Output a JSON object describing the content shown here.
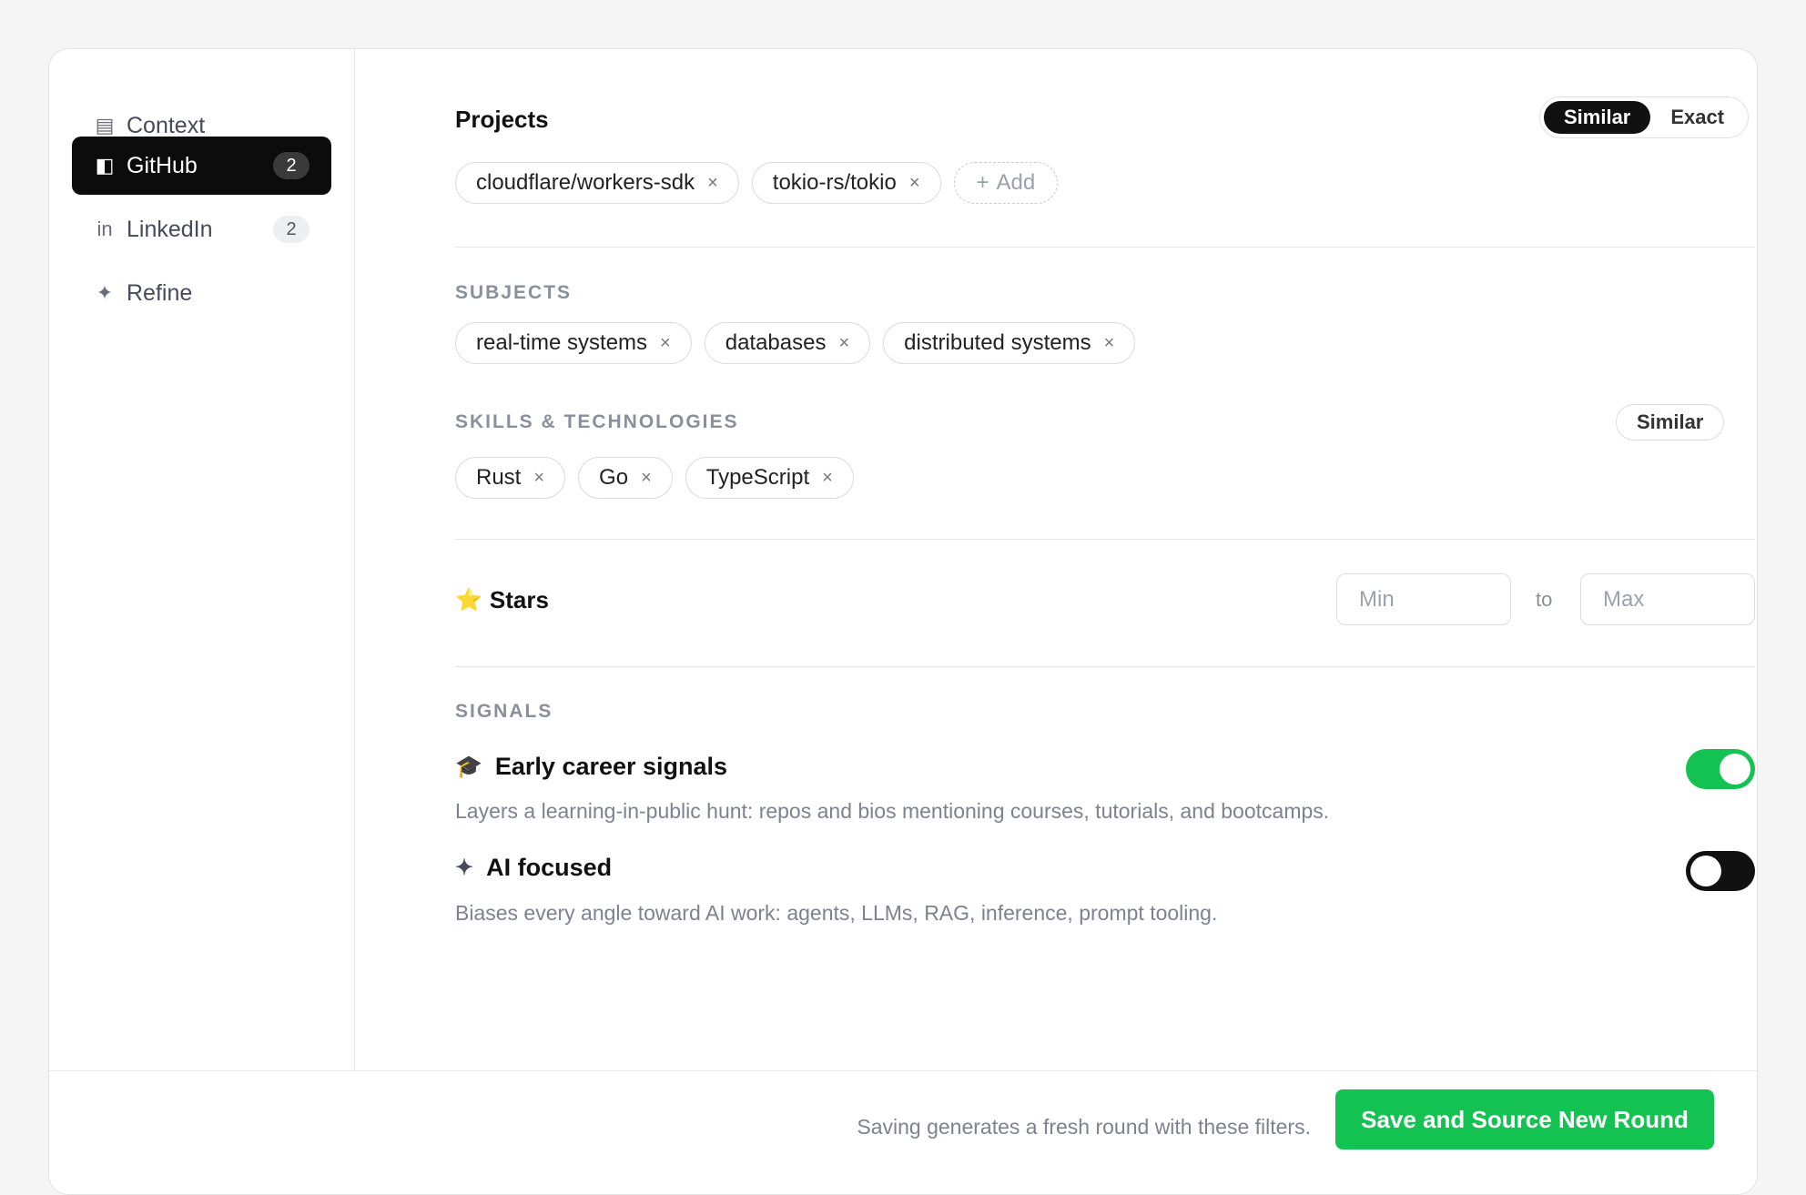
{
  "sidebar": {
    "items": [
      {
        "icon": "▤",
        "label": "Context",
        "badge": ""
      },
      {
        "icon": "◧",
        "label": "GitHub",
        "badge": "2"
      },
      {
        "icon": "in",
        "label": "LinkedIn",
        "badge": "2"
      },
      {
        "icon": "✦",
        "label": "Refine",
        "badge": ""
      }
    ],
    "active_index": 1
  },
  "projects": {
    "title": "Projects",
    "mode_options": [
      "Similar",
      "Exact"
    ],
    "selected_mode": "Similar",
    "chips": [
      "cloudflare/workers-sdk",
      "tokio-rs/tokio"
    ],
    "add_label": "Add",
    "remove_glyph": "×"
  },
  "subjects": {
    "label": "SUBJECTS",
    "chips": [
      "real-time systems",
      "databases",
      "distributed systems"
    ]
  },
  "skills": {
    "label": "SKILLS & TECHNOLOGIES",
    "mode_label": "Similar",
    "chips": [
      "Rust",
      "Go",
      "TypeScript"
    ]
  },
  "stars": {
    "icon": "⭐",
    "label": "Stars",
    "min_placeholder": "Min",
    "max_placeholder": "Max",
    "to_label": "to"
  },
  "signals": {
    "label": "SIGNALS",
    "items": [
      {
        "icon": "🎓",
        "title": "Early career signals",
        "description": "Layers a learning-in-public hunt: repos and bios mentioning courses, tutorials, and bootcamps.",
        "enabled": true
      },
      {
        "icon": "✦",
        "title": "AI focused",
        "description": "Biases every angle toward AI work: agents, LLMs, RAG, inference, prompt tooling.",
        "enabled": false
      }
    ]
  },
  "footer": {
    "note": "Saving generates a fresh round with these filters.",
    "save_label": "Save and Source New Round"
  },
  "colors": {
    "accent_green": "#14c252",
    "active_nav": "#0c0c0c",
    "muted_text": "#7d8290"
  }
}
